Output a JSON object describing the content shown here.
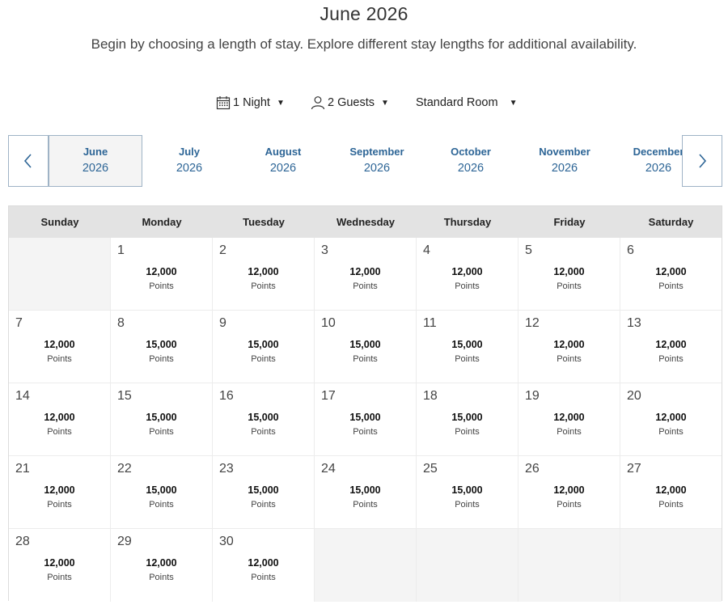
{
  "header": {
    "title": "June 2026",
    "subtitle": "Begin by choosing a length of stay. Explore different stay lengths for additional availability."
  },
  "filters": {
    "nights": {
      "label": "1 Night",
      "icon": "calendar-icon"
    },
    "guests": {
      "label": "2 Guests",
      "icon": "person-icon"
    },
    "room": {
      "label": "Standard Room"
    }
  },
  "month_nav": {
    "prev_icon": "chevron-left-icon",
    "next_icon": "chevron-right-icon",
    "active_index": 0,
    "months": [
      {
        "month": "June",
        "year": "2026"
      },
      {
        "month": "July",
        "year": "2026"
      },
      {
        "month": "August",
        "year": "2026"
      },
      {
        "month": "September",
        "year": "2026"
      },
      {
        "month": "October",
        "year": "2026"
      },
      {
        "month": "November",
        "year": "2026"
      },
      {
        "month": "December",
        "year": "2026"
      }
    ]
  },
  "calendar": {
    "weekdays": [
      "Sunday",
      "Monday",
      "Tuesday",
      "Wednesday",
      "Thursday",
      "Friday",
      "Saturday"
    ],
    "first_weekday_index": 1,
    "unit_label": "Points",
    "days": [
      {
        "day": "1",
        "points": "12,000"
      },
      {
        "day": "2",
        "points": "12,000"
      },
      {
        "day": "3",
        "points": "12,000"
      },
      {
        "day": "4",
        "points": "12,000"
      },
      {
        "day": "5",
        "points": "12,000"
      },
      {
        "day": "6",
        "points": "12,000"
      },
      {
        "day": "7",
        "points": "12,000"
      },
      {
        "day": "8",
        "points": "15,000"
      },
      {
        "day": "9",
        "points": "15,000"
      },
      {
        "day": "10",
        "points": "15,000"
      },
      {
        "day": "11",
        "points": "15,000"
      },
      {
        "day": "12",
        "points": "12,000"
      },
      {
        "day": "13",
        "points": "12,000"
      },
      {
        "day": "14",
        "points": "12,000"
      },
      {
        "day": "15",
        "points": "15,000"
      },
      {
        "day": "16",
        "points": "15,000"
      },
      {
        "day": "17",
        "points": "15,000"
      },
      {
        "day": "18",
        "points": "15,000"
      },
      {
        "day": "19",
        "points": "12,000"
      },
      {
        "day": "20",
        "points": "12,000"
      },
      {
        "day": "21",
        "points": "12,000"
      },
      {
        "day": "22",
        "points": "15,000"
      },
      {
        "day": "23",
        "points": "15,000"
      },
      {
        "day": "24",
        "points": "15,000"
      },
      {
        "day": "25",
        "points": "15,000"
      },
      {
        "day": "26",
        "points": "12,000"
      },
      {
        "day": "27",
        "points": "12,000"
      },
      {
        "day": "28",
        "points": "12,000"
      },
      {
        "day": "29",
        "points": "12,000"
      },
      {
        "day": "30",
        "points": "12,000"
      }
    ]
  }
}
